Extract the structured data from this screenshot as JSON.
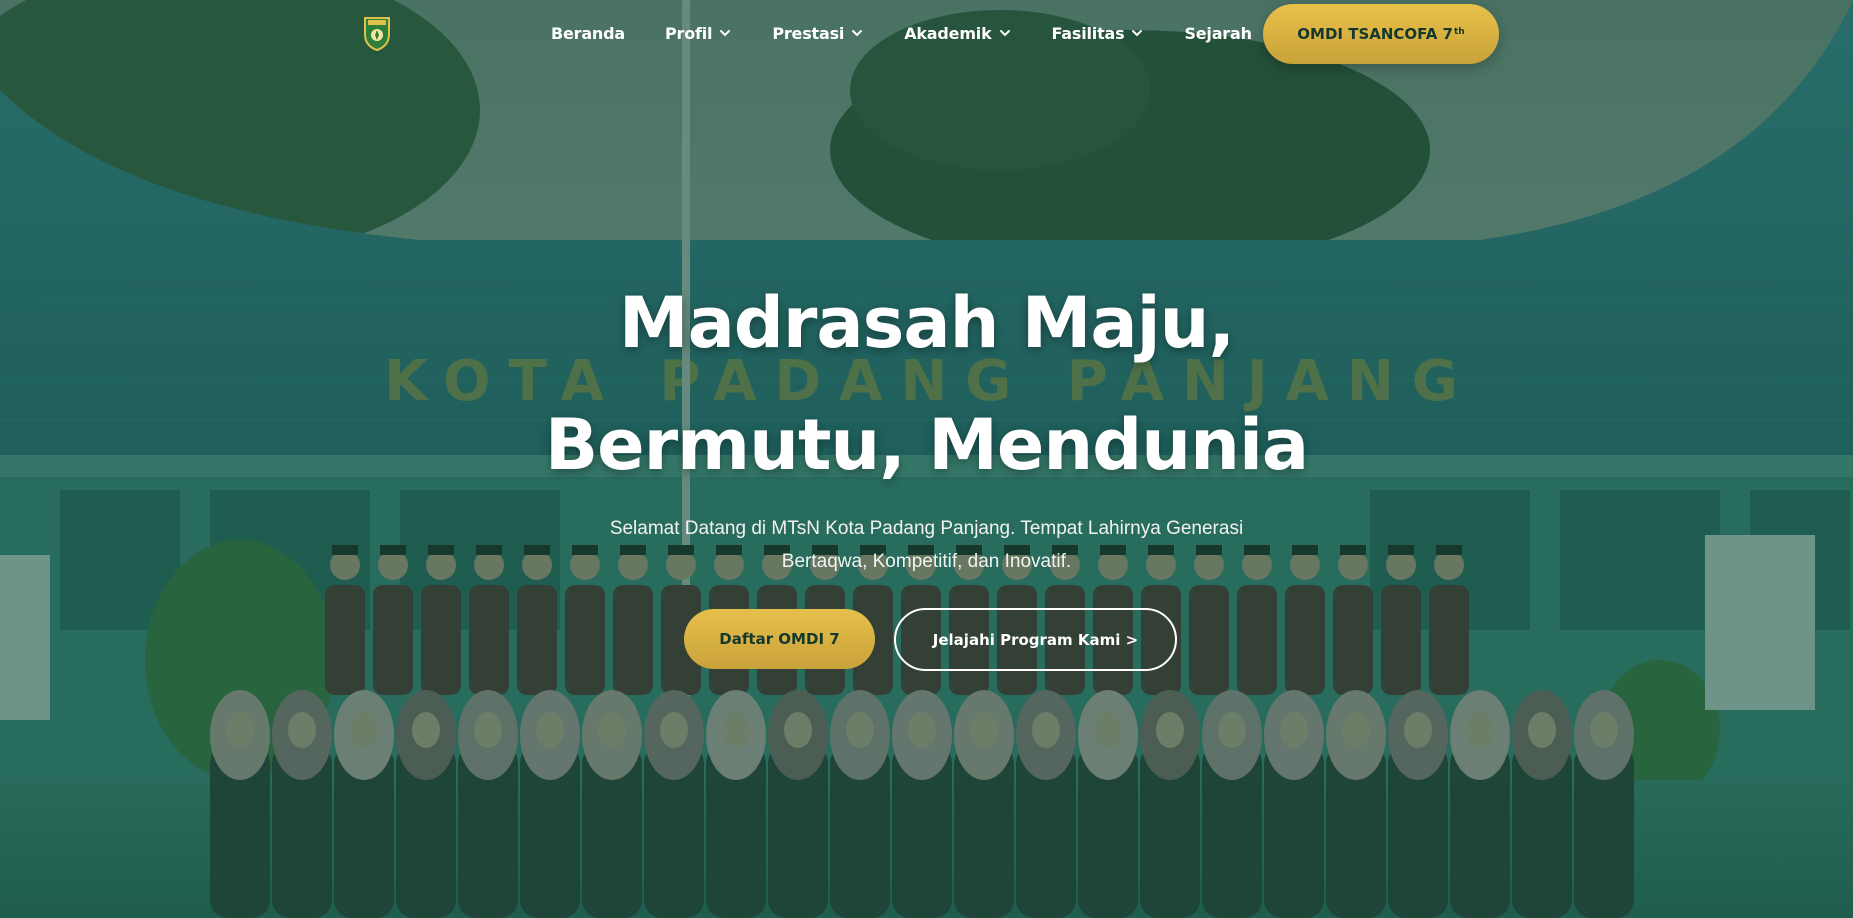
{
  "nav": {
    "items": [
      {
        "label": "Beranda",
        "has_dropdown": false
      },
      {
        "label": "Profil",
        "has_dropdown": true
      },
      {
        "label": "Prestasi",
        "has_dropdown": true
      },
      {
        "label": "Akademik",
        "has_dropdown": true
      },
      {
        "label": "Fasilitas",
        "has_dropdown": true
      },
      {
        "label": "Sejarah",
        "has_dropdown": false
      }
    ],
    "cta": {
      "label": "OMDI TSANCOFA 7",
      "sup": "th"
    }
  },
  "hero": {
    "title": "Madrasah Maju, Bermutu, Mendunia",
    "subtitle": "Selamat Datang di MTsN Kota Padang Panjang. Tempat Lahirnya Generasi Bertaqwa, Kompetitif, dan Inovatif.",
    "primary_button": "Daftar OMDI 7",
    "secondary_button": "Jelajahi Program Kami >",
    "roof_text": "KOTA PADANG PANJANG"
  },
  "colors": {
    "overlay": "#16523e",
    "accent_gold": "#e0b943",
    "text_dark": "#14382b"
  },
  "icons": {
    "logo": "school-crest-icon",
    "dropdown": "chevron-down-icon"
  }
}
